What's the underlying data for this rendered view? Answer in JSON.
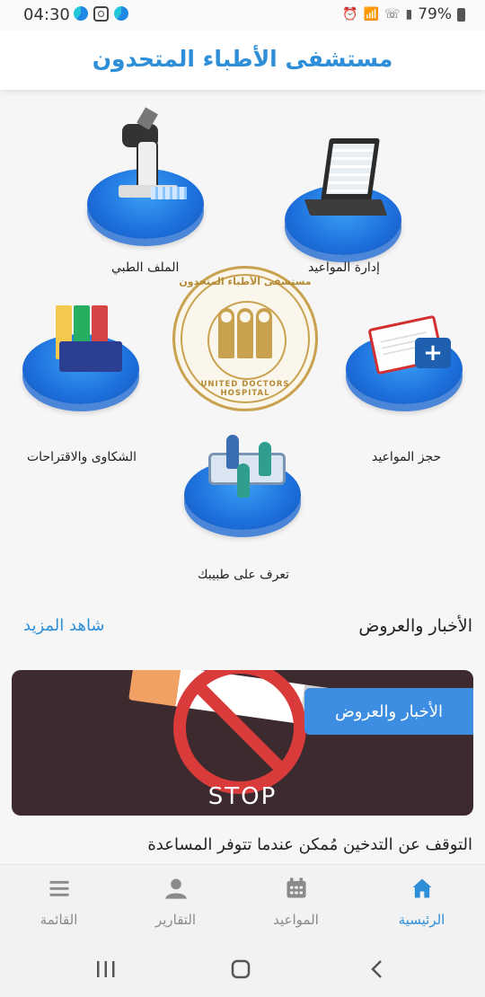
{
  "status_bar": {
    "time": "04:30",
    "battery": "79%",
    "icons": [
      "alarm-icon",
      "wifi-icon",
      "wifi-call-icon",
      "signal-icon",
      "battery-icon"
    ]
  },
  "header": {
    "title": "مستشفى الأطباء المتحدون"
  },
  "services": [
    {
      "label": "إدارة المواعيد",
      "icon": "laptop-icon"
    },
    {
      "label": "الملف الطبي",
      "icon": "microscope-icon"
    },
    {
      "label": "حجز المواعيد",
      "icon": "clipboard-medkit-icon"
    },
    {
      "label": "الشكاوى والاقتراحات",
      "icon": "file-binders-icon"
    },
    {
      "label": "تعرف على طبيبك",
      "icon": "doctor-patient-icon"
    }
  ],
  "logo": {
    "text_ar": "مستشفى الأطباء المتحدون",
    "text_en": "UNITED DOCTORS HOSPITAL"
  },
  "news": {
    "title": "الأخبار والعروض",
    "see_more": "شاهد المزيد",
    "card_badge": "الأخبار والعروض",
    "image_text": "STOP",
    "headline": "التوقف عن التدخين مُمكن عندما تتوفر المساعدة"
  },
  "bottom_nav": [
    {
      "label": "الرئيسية",
      "icon": "home-icon",
      "active": true
    },
    {
      "label": "المواعيد",
      "icon": "calendar-icon",
      "active": false
    },
    {
      "label": "التقارير",
      "icon": "user-icon",
      "active": false
    },
    {
      "label": "القائمة",
      "icon": "menu-icon",
      "active": false
    }
  ],
  "colors": {
    "accent": "#2e8fd8",
    "platform": "#1d6fdc",
    "logo_gold": "#c9a24f",
    "card_bg": "#3c2a2f",
    "badge": "#3d8ee3"
  }
}
